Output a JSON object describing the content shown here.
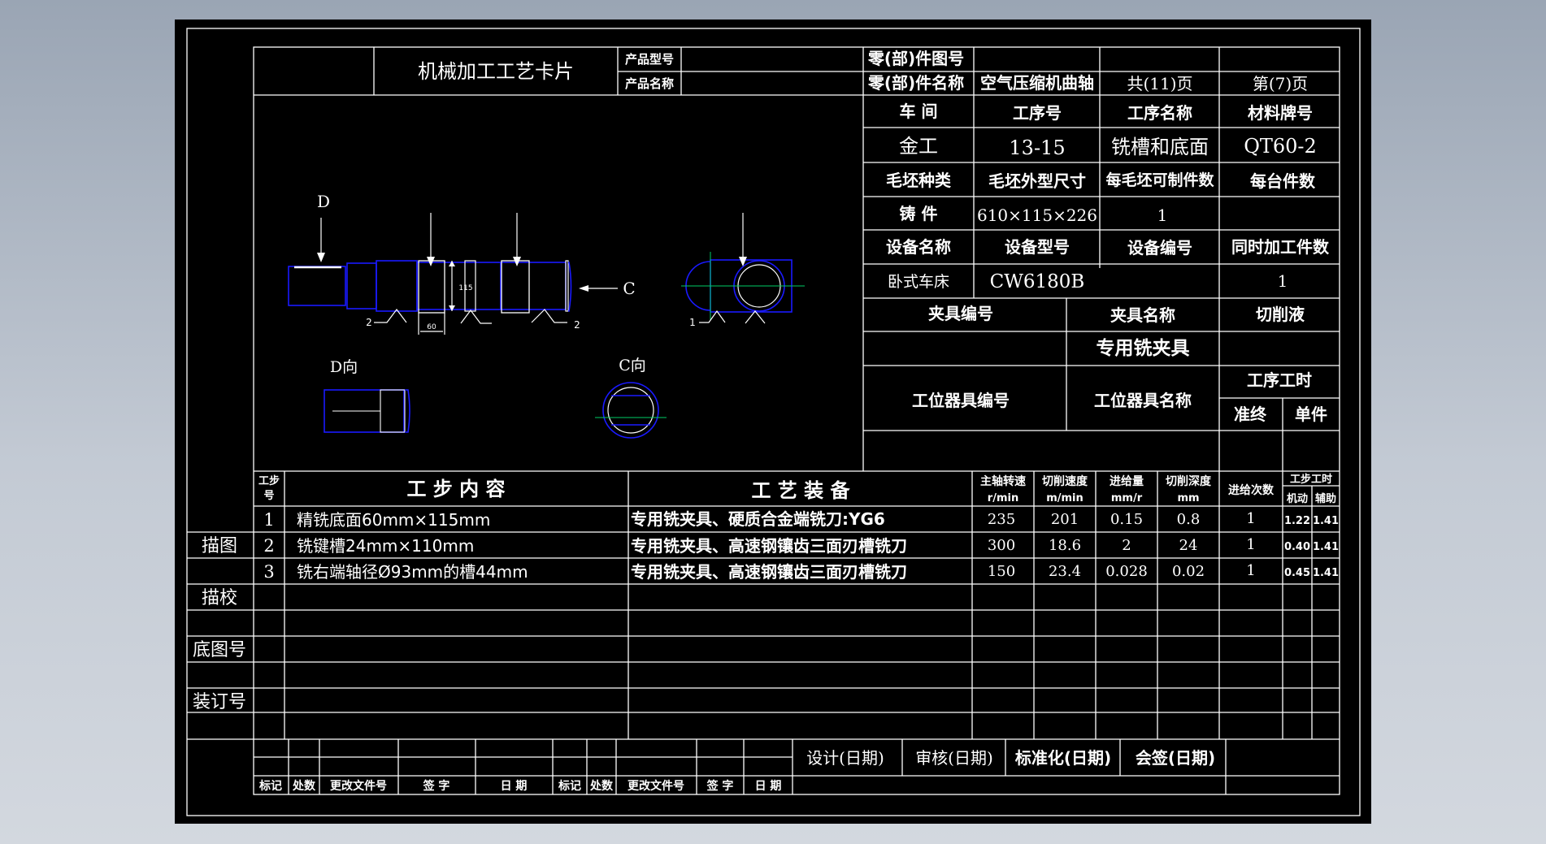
{
  "header": {
    "card_title": "机械加工工艺卡片",
    "product_model_label": "产品型号",
    "product_name_label": "产品名称",
    "part_drawing_no_label": "零(部)件图号",
    "part_name_label": "零(部)件名称",
    "part_name": "空气压缩机曲轴",
    "total_pages": "共(11)页",
    "page_no": "第(7)页"
  },
  "info": {
    "workshop_label": "车  间",
    "process_no_label": "工序号",
    "process_name_label": "工序名称",
    "material_label": "材料牌号",
    "workshop": "金工",
    "process_no": "13-15",
    "process_name": "铣槽和底面",
    "material": "QT60-2",
    "blank_type_label": "毛坯种类",
    "blank_size_label": "毛坯外型尺寸",
    "per_blank_label": "每毛坯可制件数",
    "per_unit_label": "每台件数",
    "blank_type": "铸  件",
    "blank_size": "610×115×226",
    "per_blank": "1",
    "equip_name_label": "设备名称",
    "equip_model_label": "设备型号",
    "equip_no_label": "设备编号",
    "simul_label": "同时加工件数",
    "equip_name": "卧式车床",
    "equip_model": "CW6180B",
    "simul": "1",
    "fixture_no_label": "夹具编号",
    "fixture_name_label": "夹具名称",
    "coolant_label": "切削液",
    "fixture_name": "专用铣夹具",
    "station_no_label": "工位器具编号",
    "station_name_label": "工位器具名称",
    "op_time_label": "工序工时",
    "prep_label": "准终",
    "unit_label": "单件"
  },
  "drawing": {
    "label_D": "D",
    "label_C": "C",
    "dim_115": "115",
    "dim_60": "60",
    "view_D": "D向",
    "view_C": "C向",
    "mark_1": "1",
    "mark_2a": "2",
    "mark_2b": "2"
  },
  "steps": {
    "col_step_no": [
      "工步",
      "号"
    ],
    "col_content": "工 步 内 容",
    "col_equipment": "工 艺 装 备",
    "col_speed": [
      "主轴转速",
      "r/min"
    ],
    "col_cut_speed": [
      "切削速度",
      "m/min"
    ],
    "col_feed": [
      "进给量",
      "mm/r"
    ],
    "col_depth": [
      "切削深度",
      "mm"
    ],
    "col_passes": "进给次数",
    "col_time": "工步工时",
    "col_machine": "机动",
    "col_aux": "辅助",
    "rows": [
      {
        "no": "1",
        "content": "精铣底面60mm×115mm",
        "equipment": "专用铣夹具、硬质合金端铣刀:YG6",
        "speed": "235",
        "cut_speed": "201",
        "feed": "0.15",
        "depth": "0.8",
        "passes": "1",
        "machine": "1.22",
        "aux": "1.41"
      },
      {
        "no": "2",
        "content": "铣键槽24mm×110mm",
        "equipment": "专用铣夹具、高速钢镶齿三面刃槽铣刀",
        "speed": "300",
        "cut_speed": "18.6",
        "feed": "2",
        "depth": "24",
        "passes": "1",
        "machine": "0.40",
        "aux": "1.41"
      },
      {
        "no": "3",
        "content": "铣右端轴径Ø93mm的槽44mm",
        "equipment": "专用铣夹具、高速钢镶齿三面刃槽铣刀",
        "speed": "150",
        "cut_speed": "23.4",
        "feed": "0.028",
        "depth": "0.02",
        "passes": "1",
        "machine": "0.45",
        "aux": "1.41"
      }
    ]
  },
  "side": {
    "trace": "描图",
    "trace_check": "描校",
    "base_no": "底图号",
    "binding_no": "装订号"
  },
  "footer": {
    "design": "设计(日期)",
    "review": "审核(日期)",
    "standard": "标准化(日期)",
    "countersign": "会签(日期)",
    "mark": "标记",
    "count": "处数",
    "change_doc": "更改文件号",
    "sign": "签  字",
    "date": "日  期"
  },
  "colors": {
    "background": "#000000",
    "lines": "#ffffff",
    "drawing": "#1a1aff",
    "center": "#00cc66"
  }
}
